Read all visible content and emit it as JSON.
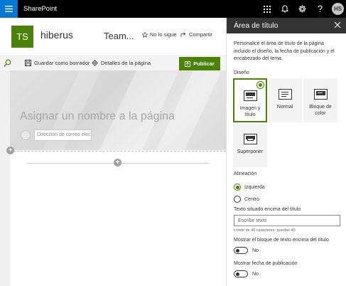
{
  "suite": {
    "brand": "SharePoint",
    "user_initials": "HS",
    "icons": [
      "waffle-icon",
      "apps-icon",
      "bell-icon",
      "gear-icon",
      "help-icon"
    ]
  },
  "site": {
    "logo_initials": "TS",
    "name": "hiberus",
    "team": "Team...",
    "follow_label": "No lo sigue",
    "share_label": "Compartir"
  },
  "commandbar": {
    "save_draft": "Guardar como borrador",
    "page_details": "Detalles de la página",
    "publish": "Publicar"
  },
  "canvas": {
    "title_placeholder": "Asignar un nombre a la página",
    "author_placeholder": "Dirección de correo elect"
  },
  "panel": {
    "title": "Área de título",
    "description": "Personalice el área de título de la página incluido el diseño, la fecha de publicación y el encabezado del tema.",
    "layout_label": "Diseño",
    "layouts": [
      {
        "label": "Imagen y título",
        "selected": true
      },
      {
        "label": "Normal",
        "selected": false
      },
      {
        "label": "Bloque de color",
        "selected": false
      },
      {
        "label": "Superponer",
        "selected": false
      }
    ],
    "alignment_label": "Alineación",
    "alignment_left": "Izquierda",
    "alignment_center": "Centro",
    "topic_label": "Texto situado encima del título",
    "topic_placeholder": "Escribir texto",
    "char_limit": "Límite de 40 caracteres: quedan 40",
    "show_topic_label": "Mostrar el bloque de texto encima del título",
    "show_topic_value": "No",
    "show_date_label": "Mostrar fecha de publicación",
    "show_date_value": "No"
  },
  "colors": {
    "accent": "#498205",
    "suite_blue": "#0078d4"
  }
}
